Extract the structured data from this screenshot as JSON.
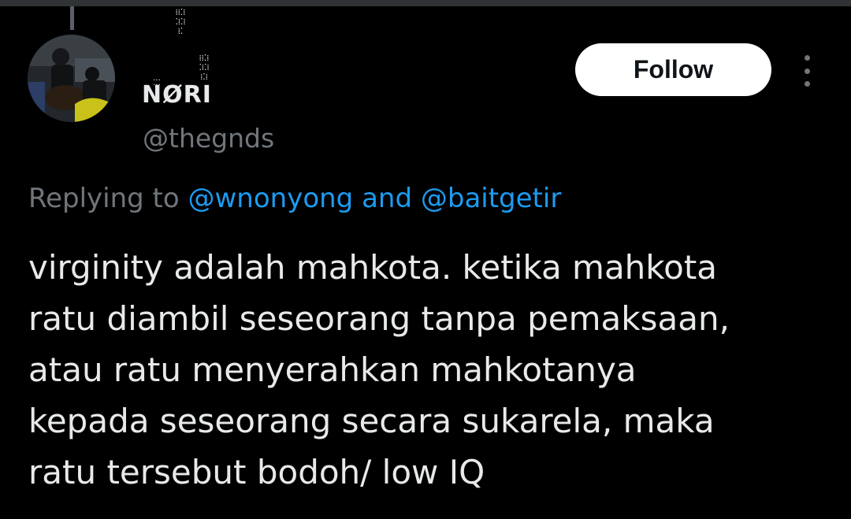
{
  "author": {
    "display_name": "NØRI",
    "handle": "@thegnds",
    "avatar": "avatar-photo"
  },
  "follow_label": "Follow",
  "more_icon": "more-options-icon",
  "reply": {
    "prefix": "Replying to",
    "mention_1": "@wnonyong",
    "joiner": "and",
    "mention_2": "@baitgetir"
  },
  "tweet_lines": [
    "virginity adalah mahkota. ketika mahkota",
    "ratu diambil seseorang tanpa pemaksaan,",
    "atau ratu menyerahkan mahkotanya",
    "kepada seseorang secara sukarela, maka",
    "ratu tersebut bodoh/ low IQ"
  ],
  "colors": {
    "background": "#000000",
    "text_primary": "#e7e9ea",
    "text_secondary": "#71767b",
    "link": "#1d9bf0",
    "button_bg": "#ffffff",
    "button_text": "#0f1419"
  }
}
